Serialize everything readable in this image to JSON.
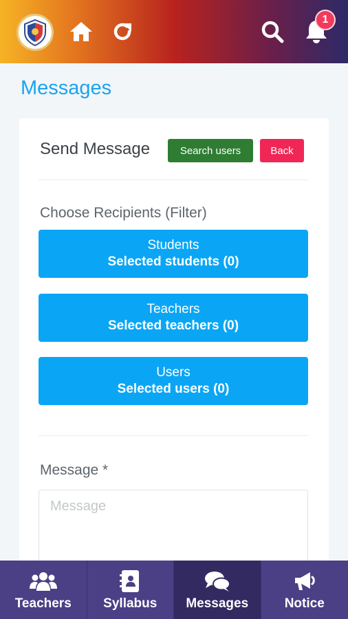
{
  "header": {
    "logo_icon": "school-crest-icon",
    "home_icon": "home-icon",
    "refresh_icon": "refresh-icon",
    "search_icon": "search-icon",
    "bell_icon": "bell-icon",
    "notification_count": "1"
  },
  "page": {
    "title": "Messages"
  },
  "form": {
    "send_title": "Send Message",
    "search_users_label": "Search users",
    "back_label": "Back",
    "filter_label": "Choose Recipients (Filter)",
    "recipients": [
      {
        "label": "Students",
        "selected": "Selected students (0)"
      },
      {
        "label": "Teachers",
        "selected": "Selected teachers (0)"
      },
      {
        "label": "Users",
        "selected": "Selected users (0)"
      }
    ],
    "message_label": "Message *",
    "message_placeholder": "Message",
    "message_value": ""
  },
  "bottom_nav": [
    {
      "label": "Teachers",
      "icon": "users-icon"
    },
    {
      "label": "Syllabus",
      "icon": "contact-book-icon"
    },
    {
      "label": "Messages",
      "icon": "chat-bubbles-icon",
      "active": true
    },
    {
      "label": "Notice",
      "icon": "megaphone-icon"
    }
  ],
  "colors": {
    "accent": "#1aa3f2",
    "recipient_button": "#0aa6f5",
    "search_users_button": "#2e7d32",
    "back_button": "#f02656",
    "badge": "#f23a5c",
    "bottom_nav": "#4b3f86"
  }
}
